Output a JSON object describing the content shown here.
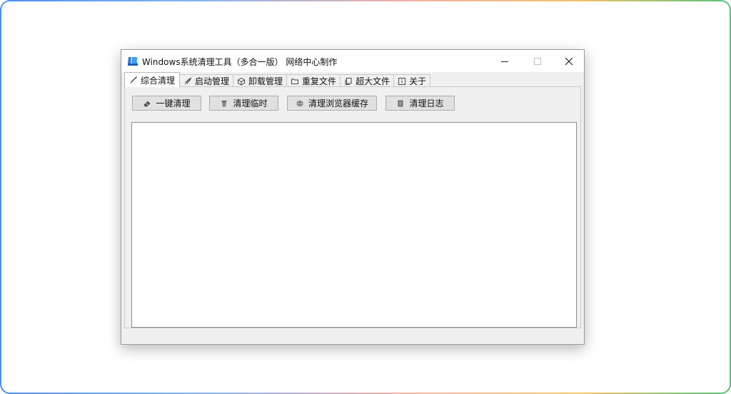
{
  "window": {
    "title": "Windows系统清理工具（多合一版） 网络中心制作",
    "app_icon": "app-logo-icon"
  },
  "tabs": [
    {
      "label": "综合清理",
      "icon": "brush-icon",
      "active": true
    },
    {
      "label": "启动管理",
      "icon": "rocket-icon",
      "active": false
    },
    {
      "label": "卸载管理",
      "icon": "package-icon",
      "active": false
    },
    {
      "label": "重复文件",
      "icon": "folder-icon",
      "active": false
    },
    {
      "label": "超大文件",
      "icon": "file-copy-icon",
      "active": false
    },
    {
      "label": "关于",
      "icon": "info-icon",
      "active": false
    }
  ],
  "toolbar": {
    "one_click_clean": "一键清理",
    "clean_temp": "清理临时",
    "clean_browser_cache": "清理浏览器缓存",
    "clean_logs": "清理日志"
  },
  "log": {
    "content": ""
  },
  "status": {
    "text": ""
  }
}
